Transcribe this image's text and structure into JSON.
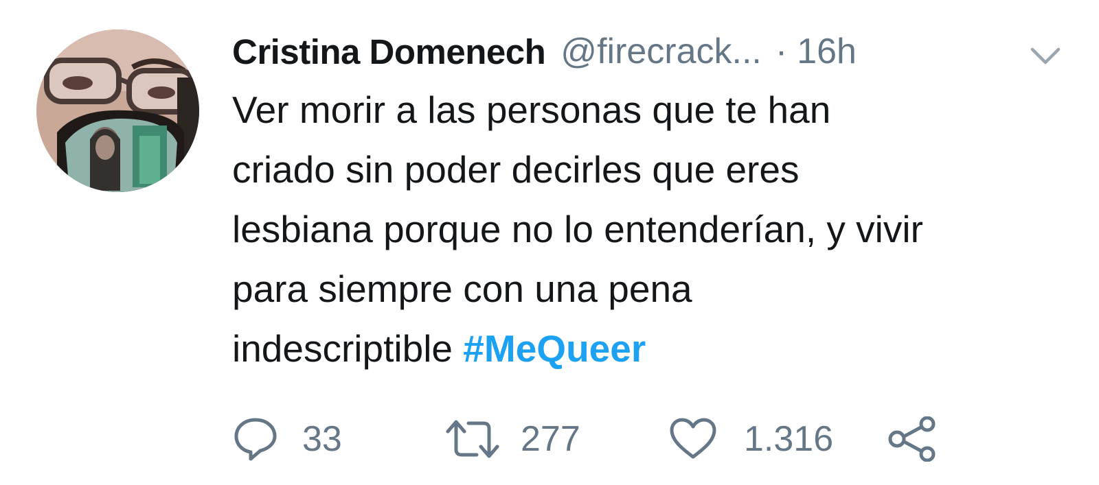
{
  "tweet": {
    "author_name": "Cristina Domenech",
    "handle": "@firecrack...",
    "separator": "·",
    "time": "16h",
    "text_lines": [
      "Ver morir a las personas que te han",
      "criado sin poder decirles que eres",
      "lesbiana porque no lo entenderían, y vivir",
      "para siempre con una pena",
      "indescriptible"
    ],
    "hashtag": "#MeQueer",
    "actions": {
      "replies": "33",
      "retweets": "277",
      "likes": "1.316"
    }
  },
  "icons": {
    "avatar": "avatar-photo",
    "more": "chevron-down-icon",
    "reply": "reply-icon",
    "retweet": "retweet-icon",
    "like": "heart-icon",
    "share": "share-icon"
  },
  "colors": {
    "text": "#14171a",
    "secondary": "#657786",
    "hashtag": "#1da1f2",
    "background": "#ffffff"
  }
}
